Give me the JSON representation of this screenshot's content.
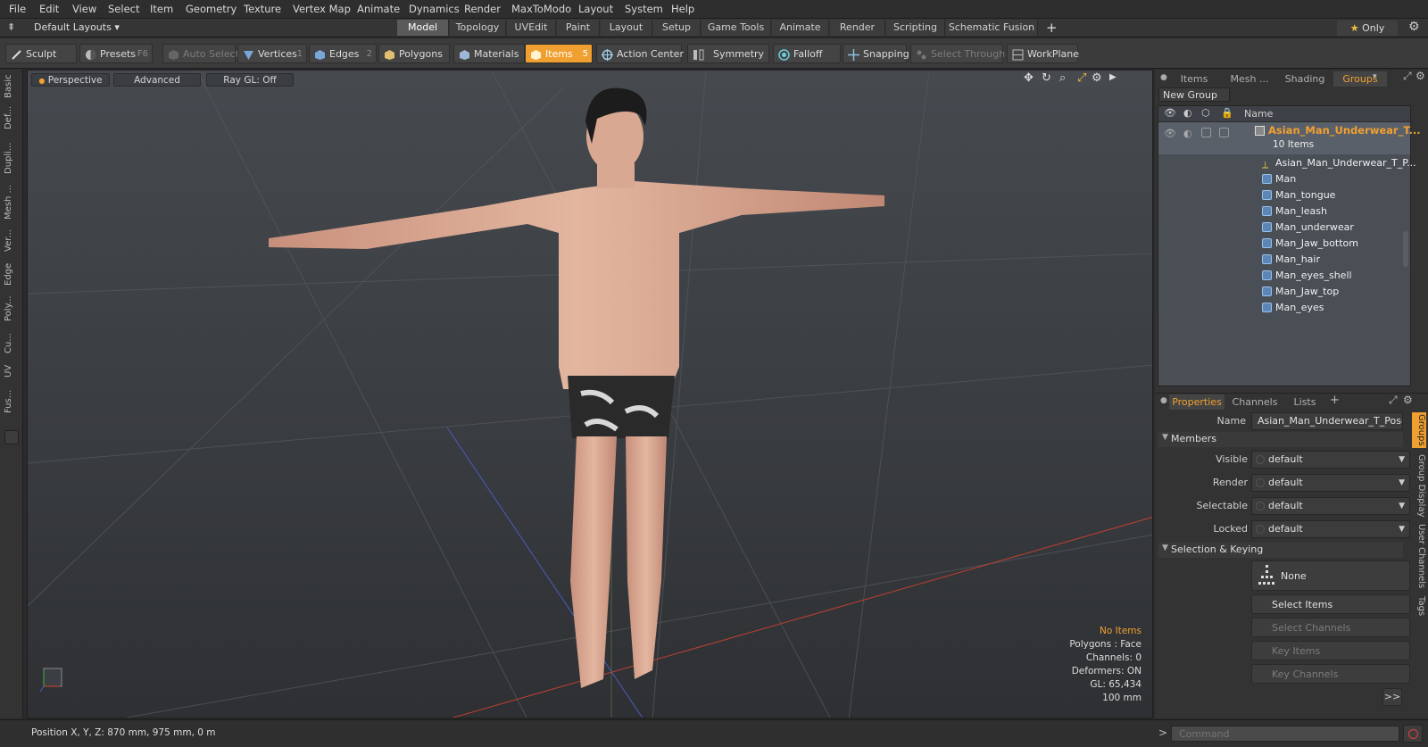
{
  "menu": [
    "File",
    "Edit",
    "View",
    "Select",
    "Item",
    "Geometry",
    "Texture",
    "Vertex Map",
    "Animate",
    "Dynamics",
    "Render",
    "MaxToModo",
    "Layout",
    "System",
    "Help"
  ],
  "layout_selector": "Default Layouts",
  "layout_tabs": [
    "Model",
    "Topology",
    "UVEdit",
    "Paint",
    "Layout",
    "Setup",
    "Game Tools",
    "Animate",
    "Render",
    "Scripting",
    "Schematic Fusion"
  ],
  "layout_tab_active": "Model",
  "only_label": "Only",
  "toolbar": {
    "sculpt": "Sculpt",
    "presets": "Presets",
    "presets_key": "F6",
    "auto_select": "Auto Select",
    "vertices": "Vertices",
    "vertices_key": "1",
    "edges": "Edges",
    "edges_key": "2",
    "polygons": "Polygons",
    "materials": "Materials",
    "items": "Items",
    "items_key": "5",
    "action_center": "Action Center",
    "symmetry": "Symmetry",
    "falloff": "Falloff",
    "snapping": "Snapping",
    "select_through": "Select Through",
    "workplane": "WorkPlane"
  },
  "left_tabs": [
    "Basic",
    "Def...",
    "Dupli...",
    "Mesh ...",
    "Ver...",
    "Edge",
    "Poly...",
    "Cu...",
    "UV",
    "Fus..."
  ],
  "viewport": {
    "view": "Perspective",
    "advanced": "Advanced",
    "raygl": "Ray GL: Off",
    "info": {
      "items": "No Items",
      "polygons": "Polygons : Face",
      "channels": "Channels: 0",
      "deformers": "Deformers: ON",
      "gl": "GL: 65,434",
      "scale": "100 mm"
    }
  },
  "right_tabs": [
    "Items",
    "Mesh ...",
    "Shading",
    "Groups"
  ],
  "right_tab_active": "Groups",
  "new_group": "New Group",
  "list_header_name": "Name",
  "group": {
    "name": "Asian_Man_Underwear_T...",
    "count": "10 Items",
    "members": [
      "Asian_Man_Underwear_T_P...",
      "Man",
      "Man_tongue",
      "Man_leash",
      "Man_underwear",
      "Man_Jaw_bottom",
      "Man_hair",
      "Man_eyes_shell",
      "Man_Jaw_top",
      "Man_eyes"
    ]
  },
  "prop_tabs": [
    "Properties",
    "Channels",
    "Lists"
  ],
  "prop_tab_active": "Properties",
  "props": {
    "name_label": "Name",
    "name_value": "Asian_Man_Underwear_T_Pose (",
    "members_section": "Members",
    "visible_label": "Visible",
    "visible_value": "default",
    "render_label": "Render",
    "render_value": "default",
    "selectable_label": "Selectable",
    "selectable_value": "default",
    "locked_label": "Locked",
    "locked_value": "default",
    "selkey_section": "Selection & Keying",
    "none_label": "None",
    "select_items": "Select Items",
    "select_channels": "Select Channels",
    "key_items": "Key Items",
    "key_channels": "Key Channels",
    "more": ">>"
  },
  "side_tabs": [
    "Groups",
    "Group Display",
    "User Channels",
    "Tags"
  ],
  "status": {
    "position": "Position X, Y, Z:  870 mm, 975 mm, 0 m",
    "command_placeholder": "Command"
  },
  "colors": {
    "accent": "#f0a030",
    "selected_item": "#f0a030"
  }
}
